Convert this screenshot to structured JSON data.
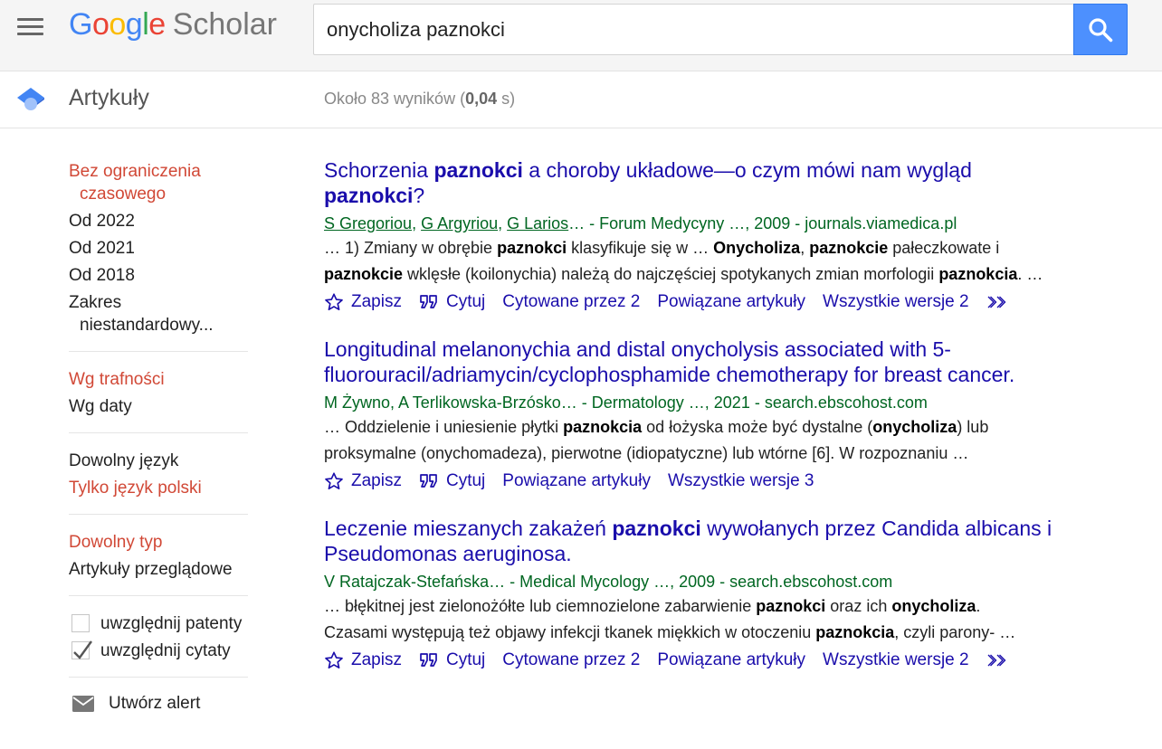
{
  "header": {
    "logo_google": [
      "G",
      "o",
      "o",
      "g",
      "l",
      "e"
    ],
    "logo_google_colors": [
      "#4285f4",
      "#ea4335",
      "#fbbc05",
      "#4285f4",
      "#34a853",
      "#ea4335"
    ],
    "logo_scholar": "Scholar",
    "search_value": "onycholiza paznokci",
    "icons": {
      "menu": "hamburger-menu-icon",
      "search": "magnifier-icon"
    },
    "accent_color": "#4d90fe"
  },
  "subheader": {
    "section_title": "Artykuły",
    "count_prefix": "Około 83 wyników (",
    "count_time": "0,04",
    "count_suffix": " s)"
  },
  "sidebar": {
    "time": {
      "any_line1": "Bez ograniczenia",
      "any_line2": "czasowego",
      "since_2022": "Od 2022",
      "since_2021": "Od 2021",
      "since_2018": "Od 2018",
      "custom_line1": "Zakres",
      "custom_line2": "niestandardowy..."
    },
    "sort": {
      "relevance": "Wg trafności",
      "date": "Wg daty"
    },
    "language": {
      "any": "Dowolny język",
      "polish": "Tylko język polski"
    },
    "type": {
      "any": "Dowolny typ",
      "review": "Artykuły przeglądowe"
    },
    "options": {
      "patents": "uwzględnij patenty",
      "patents_checked": false,
      "citations": "uwzględnij cytaty",
      "citations_checked": true
    },
    "alert": "Utwórz alert",
    "active_color": "#d14836"
  },
  "results": [
    {
      "title_parts": [
        "Schorzenia ",
        "paznokci",
        " a choroby układowe—o czym mówi nam wygląd ",
        "paznokci",
        "?"
      ],
      "authors": [
        "S Gregoriou",
        "G Argyriou",
        "G Larios"
      ],
      "meta_tail": "… - Forum Medycyny …, 2009 - journals.viamedica.pl",
      "snippet": [
        [
          "… 1) Zmiany w obrębie ",
          "paznokci",
          " klasyfikuje się w … ",
          "Onycholiza",
          ", ",
          "paznokcie",
          " pałeczkowate i"
        ],
        [
          "paznokcie",
          " wklęsłe (koilonychia) należą do najczęściej spotykanych zmian morfologii ",
          "paznokcia",
          ". …"
        ]
      ],
      "save": "Zapisz",
      "cite": "Cytuj",
      "cited_by": "Cytowane przez 2",
      "related": "Powiązane artykuły",
      "versions": "Wszystkie wersje 2"
    },
    {
      "title_line1": "Longitudinal melanonychia and distal onycholysis associated with 5-",
      "title_line2": "fluorouracil/adriamycin/cyclophosphamide chemotherapy for breast cancer.",
      "meta": "M Żywno, A Terlikowska-Brzósko… - Dermatology …, 2021 - search.ebscohost.com",
      "snippet": [
        [
          "… Oddzielenie i uniesienie płytki ",
          "paznokcia",
          " od łożyska może być dystalne (",
          "onycholiza",
          ") lub"
        ],
        [
          "proksymalne (onychomadeza), pierwotne (idiopatyczne) lub wtórne [6]. W rozpoznaniu …"
        ]
      ],
      "save": "Zapisz",
      "cite": "Cytuj",
      "related": "Powiązane artykuły",
      "versions": "Wszystkie wersje 3"
    },
    {
      "title_parts": [
        "Leczenie mieszanych zakażeń ",
        "paznokci",
        " wywołanych przez Candida albicans i Pseudomonas aeruginosa."
      ],
      "meta": "V Ratajczak-Stefańska… - Medical Mycology …, 2009 - search.ebscohost.com",
      "snippet": [
        [
          "… błękitnej jest zielonożółte lub ciemnozielone zabarwienie ",
          "paznokci",
          " oraz ich ",
          "onycholiza",
          "."
        ],
        [
          "Czasami występują też objawy infekcji tkanek miękkich w otoczeniu ",
          "paznokcia",
          ", czyli parony- …"
        ]
      ],
      "save": "Zapisz",
      "cite": "Cytuj",
      "cited_by": "Cytowane przez 2",
      "related": "Powiązane artykuły",
      "versions": "Wszystkie wersje 2"
    }
  ],
  "link_icons": {
    "save": "star-icon",
    "cite": "quote-icon",
    "more": "double-chevron-icon"
  },
  "colors": {
    "link": "#1a0dab",
    "meta": "#006621",
    "muted": "#888888"
  }
}
